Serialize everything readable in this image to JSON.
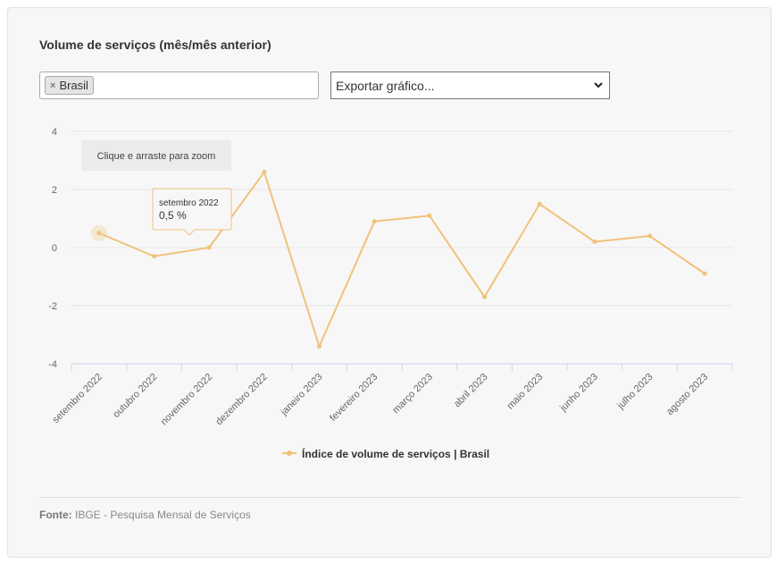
{
  "title": "Volume de serviços (mês/mês anterior)",
  "filter": {
    "chip_label": "Brasil",
    "chip_remove": "×"
  },
  "export_select": {
    "selected": "Exportar gráfico..."
  },
  "zoom_hint": "Clique e arraste para zoom",
  "tooltip": {
    "label": "setembro 2022",
    "value": "0,5 %"
  },
  "colors": {
    "series": "#f0c27b",
    "grid": "#e6e6e6",
    "axis": "#ccd6eb"
  },
  "source": {
    "label": "Fonte:",
    "text": "IBGE - Pesquisa Mensal de Serviços"
  },
  "chart_data": {
    "type": "line",
    "categories": [
      "setembro 2022",
      "outubro 2022",
      "novembro 2022",
      "dezembro 2022",
      "janeiro 2023",
      "fevereiro 2023",
      "março 2023",
      "abril 2023",
      "maio 2023",
      "junho 2023",
      "julho 2023",
      "agosto 2023"
    ],
    "series": [
      {
        "name": "Índice de volume de serviços | Brasil",
        "values": [
          0.5,
          -0.3,
          0.0,
          2.6,
          -3.4,
          0.9,
          1.1,
          -1.7,
          1.5,
          0.2,
          0.4,
          -0.9
        ]
      }
    ],
    "ylim": [
      -4,
      4
    ],
    "yticks": [
      "4",
      "2",
      "0",
      "-2",
      "-4"
    ],
    "ytick_values": [
      4,
      2,
      0,
      -2,
      -4
    ],
    "grid": true,
    "legend": "bottom-center"
  }
}
